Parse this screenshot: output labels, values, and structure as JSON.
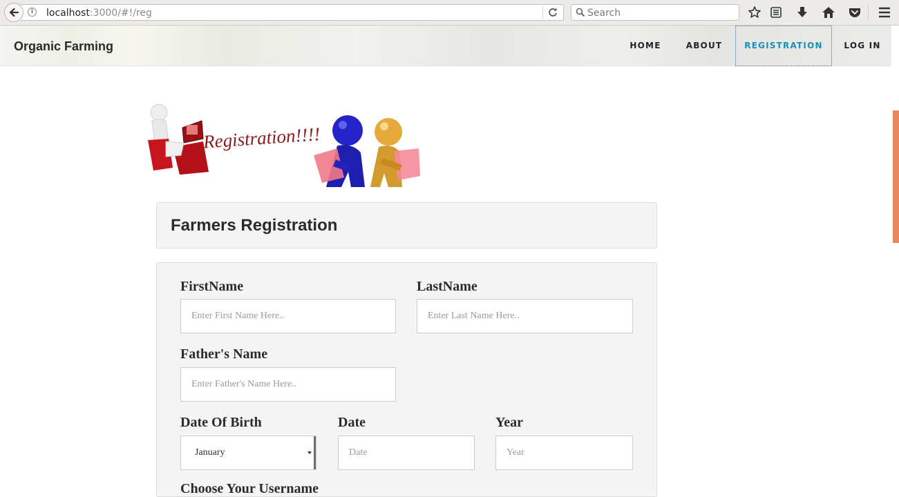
{
  "browser": {
    "url_host": "localhost",
    "url_rest": ":3000/#!/reg",
    "search_placeholder": "Search",
    "icons": [
      "back-icon",
      "info-icon",
      "reload-icon",
      "search-icon",
      "bookmark-star-icon",
      "reading-list-icon",
      "download-icon",
      "home-icon",
      "pocket-icon",
      "menu-icon"
    ]
  },
  "navbar": {
    "brand": "Organic Farming",
    "items": [
      {
        "label": "HOME",
        "active": false
      },
      {
        "label": "ABOUT",
        "active": false
      },
      {
        "label": "REGISTRATION",
        "active": true
      },
      {
        "label": "LOG IN",
        "active": false
      }
    ]
  },
  "banner": {
    "text": "Registration!!!!"
  },
  "form": {
    "title": "Farmers Registration",
    "first_name_label": "FirstName",
    "first_name_placeholder": "Enter First Name Here..",
    "last_name_label": "LastName",
    "last_name_placeholder": "Enter Last Name Here..",
    "father_name_label": "Father's Name",
    "father_name_placeholder": "Enter Father's Name Here..",
    "dob_label": "Date Of Birth",
    "month_selected": "January",
    "date_label": "Date",
    "date_placeholder": "Date",
    "year_label": "Year",
    "year_placeholder": "Year",
    "username_label": "Choose Your Username"
  },
  "colors": {
    "accent": "#1a8fb8",
    "scroll_thumb": "#e8895d",
    "panel_bg": "#f4f4f4"
  }
}
